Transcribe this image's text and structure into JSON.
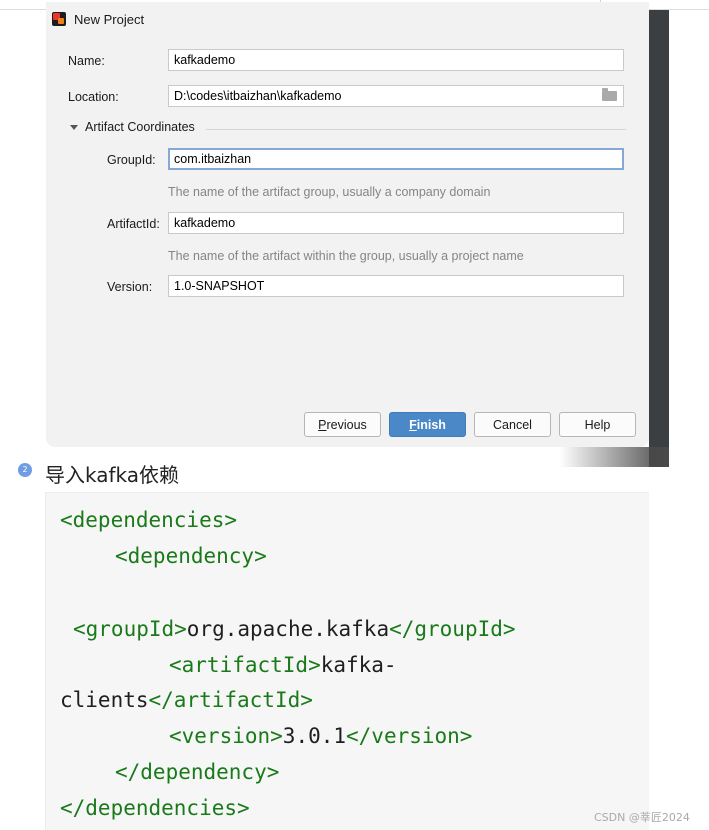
{
  "dialog": {
    "title": "New Project",
    "name_label": "Name:",
    "name_value": "kafkademo",
    "location_label": "Location:",
    "location_value": "D:\\codes\\itbaizhan\\kafkademo",
    "section_label": "Artifact Coordinates",
    "groupid_label": "GroupId:",
    "groupid_value": "com.itbaizhan",
    "groupid_hint": "The name of the artifact group, usually a company domain",
    "artifactid_label": "ArtifactId:",
    "artifactid_value": "kafkademo",
    "artifactid_hint": "The name of the artifact within the group, usually a project name",
    "version_label": "Version:",
    "version_value": "1.0-SNAPSHOT",
    "buttons": {
      "previous_mnemonic": "P",
      "previous_rest": "revious",
      "finish_mnemonic": "F",
      "finish_rest": "inish",
      "cancel": "Cancel",
      "help": "Help"
    }
  },
  "step": {
    "number": "2",
    "title": "导入kafka依赖"
  },
  "code": {
    "l1_tag": "<dependencies>",
    "l2_tag": "<dependency>",
    "l3_open": "<groupId>",
    "l3_text": "org.apache.kafka",
    "l3_close": "</groupId>",
    "l4_open": "<artifactId>",
    "l4_text": "kafka-",
    "l5_text": "clients",
    "l5_close": "</artifactId>",
    "l6_open": "<version>",
    "l6_text": "3.0.1",
    "l6_close": "</version>",
    "l7_tag": "</dependency>",
    "l8_tag": "</dependencies>"
  },
  "watermark": "CSDN @莘匠2024",
  "colors": {
    "dialog_bg": "#f2f2f2",
    "primary_button": "#4a88c7",
    "xml_tag": "#1a7a1a",
    "step_badge": "#6f9de3"
  }
}
